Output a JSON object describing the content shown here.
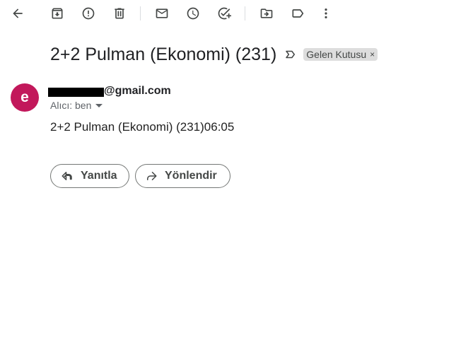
{
  "toolbar": {
    "buttons": [
      {
        "icon": "arrow-back"
      },
      {
        "icon": "archive"
      },
      {
        "icon": "report-spam"
      },
      {
        "icon": "delete"
      },
      {
        "icon": "mark-unread"
      },
      {
        "icon": "snooze"
      },
      {
        "icon": "add-task"
      },
      {
        "icon": "move-to"
      },
      {
        "icon": "label"
      },
      {
        "icon": "more-vert"
      }
    ]
  },
  "message": {
    "subject": "2+2 Pulman (Ekonomi) (231)",
    "label_chip": {
      "text": "Gelen Kutusu",
      "remove": "×"
    },
    "sender": {
      "avatar_letter": "e",
      "avatar_color": "#c2185b",
      "email_domain": "@gmail.com"
    },
    "recipient_text": "Alıcı: ben",
    "body": "2+2 Pulman (Ekonomi) (231)06:05"
  },
  "actions": {
    "reply_label": "Yanıtla",
    "forward_label": "Yönlendir"
  }
}
